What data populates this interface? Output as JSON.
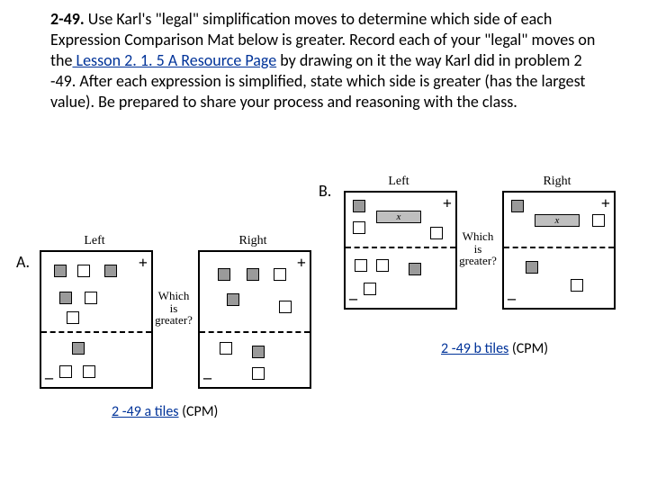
{
  "problem": {
    "number": "2-49.",
    "text_before_link": "Use Karl's \"legal\" simplification moves to determine which side of each Expression Comparison Mat below is greater.  Record each of your \"legal\" moves on the",
    "link_text": " Lesson 2. 1. 5 A Resource Page",
    "text_after_link": " by drawing on it the way Karl did in problem 2 -49.  After each expression is simplified, state which side is greater (has the largest value).  Be prepared to share your process and reasoning with the class."
  },
  "labels": {
    "A": "A.",
    "B": "B."
  },
  "between_text": "Which is greater?",
  "mat_titles": {
    "left": "Left",
    "right": "Right"
  },
  "signs": {
    "plus": "+",
    "minus": "–"
  },
  "xvar": "x",
  "links": {
    "a": {
      "text": "2 -49 a tiles",
      "suffix": " (CPM)"
    },
    "b": {
      "text": "2 -49 b tiles",
      "suffix": " (CPM)"
    }
  }
}
